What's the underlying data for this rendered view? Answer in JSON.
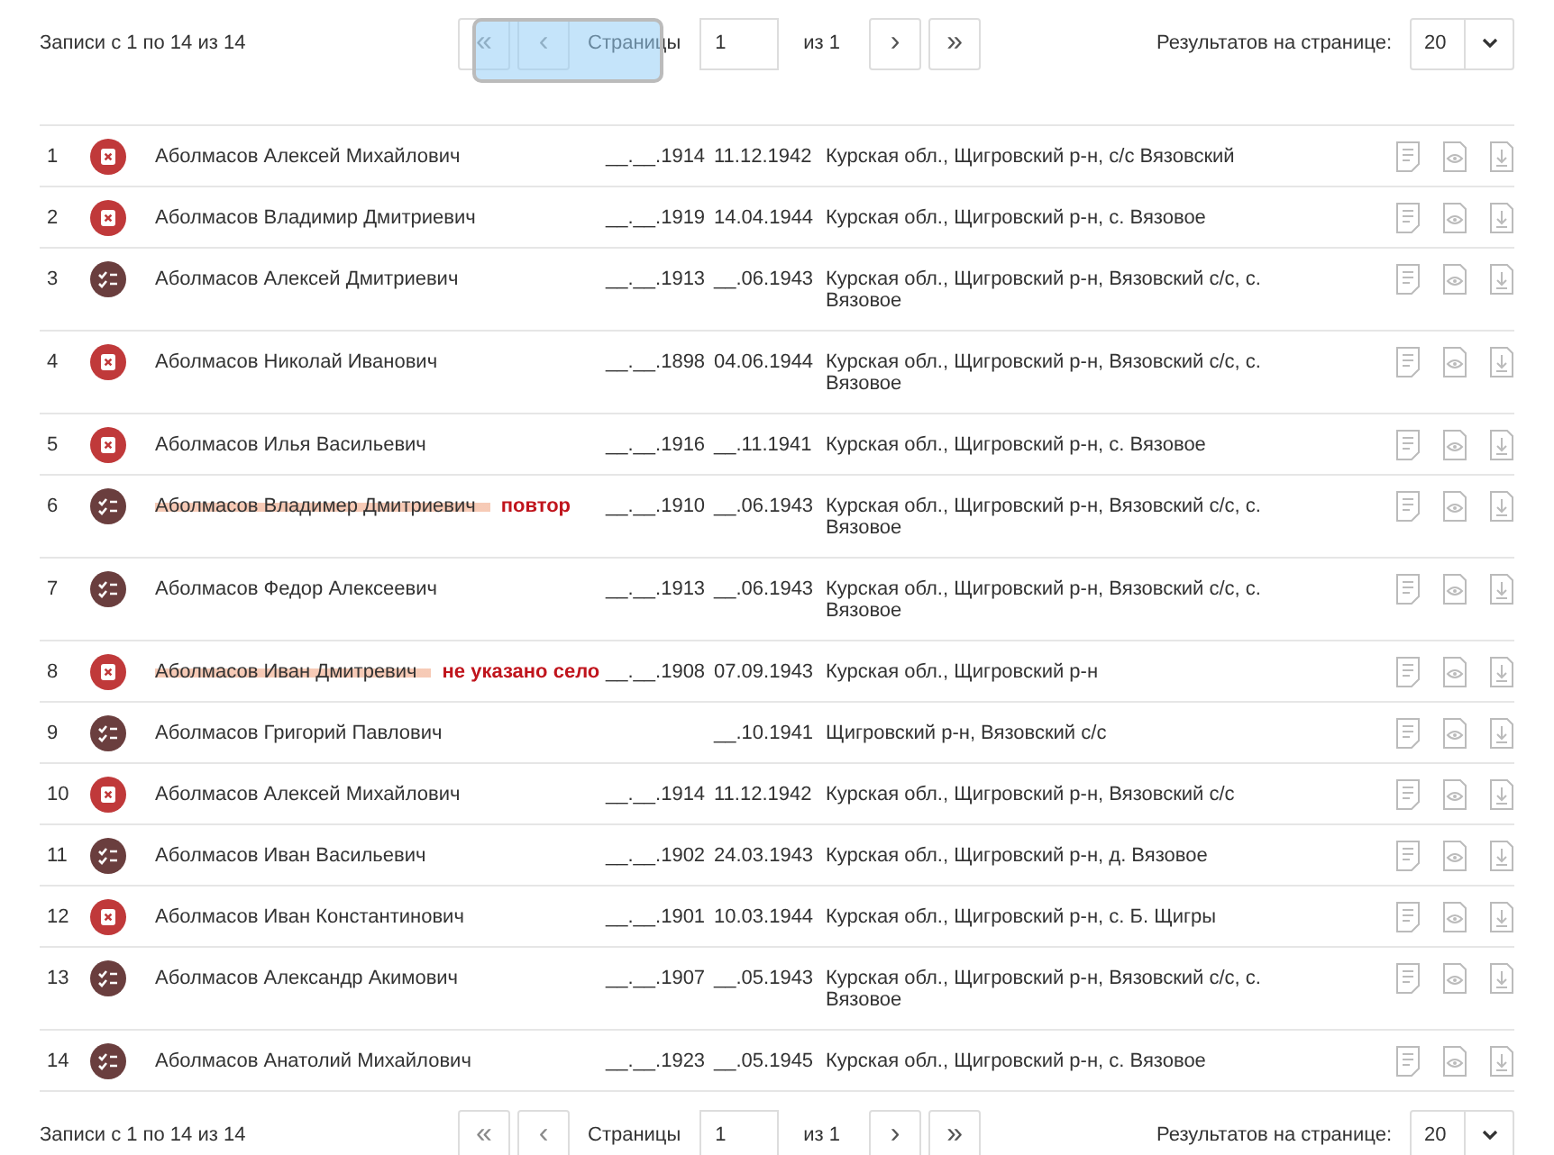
{
  "top_pager": {
    "records": "Записи с 1 по 14 из 14",
    "first": {
      "label": "«",
      "disabled": true
    },
    "prev": {
      "label": "‹",
      "disabled": true
    },
    "pages_label": "Страницы",
    "page_value": "1",
    "page_total": "из 1",
    "next": {
      "label": "›",
      "disabled": false
    },
    "last": {
      "label": "»",
      "disabled": false
    },
    "per_page_label": "Результатов на странице:",
    "per_page_value": "20",
    "overlay": true
  },
  "rows": [
    {
      "number": "1",
      "rejected": true,
      "name": "Аболмасов Алексей Михайлович",
      "highlighted": false,
      "birth": "__.__.1914",
      "death": "11.12.1942",
      "place": "Курская обл., Щигровский р-н, с/с Вязовский"
    },
    {
      "number": "2",
      "rejected": true,
      "name": "Аболмасов Владимир Дмитриевич",
      "highlighted": false,
      "birth": "__.__.1919",
      "death": "14.04.1944",
      "place": "Курская обл., Щигровский р-н, с. Вязовое"
    },
    {
      "number": "3",
      "rejected": false,
      "name": "Аболмасов Алексей Дмитриевич",
      "highlighted": false,
      "birth": "__.__.1913",
      "death": "__.06.1943",
      "place": "Курская обл., Щигровский р-н, Вязовский с/с, с. Вязовое"
    },
    {
      "number": "4",
      "rejected": true,
      "name": "Аболмасов Николай Иванович",
      "highlighted": false,
      "birth": "__.__.1898",
      "death": "04.06.1944",
      "place": "Курская обл., Щигровский р-н, Вязовский с/с, с. Вязовое"
    },
    {
      "number": "5",
      "rejected": true,
      "name": "Аболмасов Илья Васильевич",
      "highlighted": false,
      "birth": "__.__.1916",
      "death": "__.11.1941",
      "place": "Курская обл., Щигровский р-н, с. Вязовое"
    },
    {
      "number": "6",
      "rejected": false,
      "name": "Аболмасов Владимер Дмитриевич",
      "highlighted": true,
      "note": "повтор",
      "birth": "__.__.1910",
      "death": "__.06.1943",
      "place": "Курская обл., Щигровский р-н, Вязовский с/с, с. Вязовое"
    },
    {
      "number": "7",
      "rejected": false,
      "name": "Аболмасов Федор Алексеевич",
      "highlighted": false,
      "birth": "__.__.1913",
      "death": "__.06.1943",
      "place": "Курская обл., Щигровский р-н, Вязовский с/с, с. Вязовое"
    },
    {
      "number": "8",
      "rejected": true,
      "name": "Аболмасов Иван Дмитревич",
      "highlighted": true,
      "note": "не указано село",
      "birth": "__.__.1908",
      "death": "07.09.1943",
      "place": "Курская обл., Щигровский р-н"
    },
    {
      "number": "9",
      "rejected": false,
      "name": "Аболмасов Григорий Павлович",
      "highlighted": false,
      "death": "__.10.1941",
      "place": "Щигровский р-н, Вязовский с/с"
    },
    {
      "number": "10",
      "rejected": true,
      "name": "Аболмасов Алексей Михайлович",
      "highlighted": false,
      "birth": "__.__.1914",
      "death": "11.12.1942",
      "place": "Курская обл., Щигровский р-н, Вязовский с/с"
    },
    {
      "number": "11",
      "rejected": false,
      "name": "Аболмасов Иван Васильевич",
      "highlighted": false,
      "birth": "__.__.1902",
      "death": "24.03.1943",
      "place": "Курская обл., Щигровский р-н, д. Вязовое"
    },
    {
      "number": "12",
      "rejected": true,
      "name": "Аболмасов Иван Константинович",
      "highlighted": false,
      "birth": "__.__.1901",
      "death": "10.03.1944",
      "place": "Курская обл., Щигровский р-н, с. Б. Щигры"
    },
    {
      "number": "13",
      "rejected": false,
      "name": "Аболмасов Александр Акимович",
      "highlighted": false,
      "birth": "__.__.1907",
      "death": "__.05.1943",
      "place": "Курская обл., Щигровский р-н, Вязовский с/с, с. Вязовое"
    },
    {
      "number": "14",
      "rejected": false,
      "name": "Аболмасов Анатолий Михайлович",
      "highlighted": false,
      "birth": "__.__.1923",
      "death": "__.05.1945",
      "place": "Курская обл., Щигровский р-н, с. Вязовое"
    }
  ],
  "bottom_pager": {
    "records": "Записи с 1 по 14 из 14",
    "first": {
      "label": "«",
      "disabled": true
    },
    "prev": {
      "label": "‹",
      "disabled": true
    },
    "pages_label": "Страницы",
    "page_value": "1",
    "page_total": "из 1",
    "next": {
      "label": "›",
      "disabled": false
    },
    "last": {
      "label": "»",
      "disabled": false
    },
    "per_page_label": "Результатов на странице:",
    "per_page_value": "20"
  }
}
